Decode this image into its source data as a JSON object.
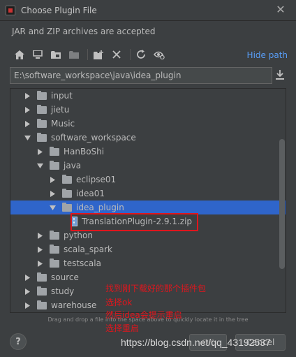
{
  "window": {
    "title": "Choose Plugin File",
    "close_icon": "close-icon"
  },
  "subtitle": "JAR and ZIP archives are accepted",
  "toolbar": {
    "buttons": [
      "home-icon",
      "desktop-icon",
      "project-icon",
      "module-icon",
      "new-folder-icon",
      "delete-icon",
      "refresh-icon",
      "show-hidden-icon"
    ],
    "hide_path_label": "Hide path"
  },
  "path": {
    "value": "E:\\software_workspace\\java\\idea_plugin"
  },
  "tree": {
    "rows": [
      {
        "label": "input",
        "type": "folder",
        "expanded": false,
        "depth": 0
      },
      {
        "label": "jietu",
        "type": "folder",
        "expanded": false,
        "depth": 0
      },
      {
        "label": "Music",
        "type": "folder",
        "expanded": false,
        "depth": 0
      },
      {
        "label": "software_workspace",
        "type": "folder",
        "expanded": true,
        "depth": 0
      },
      {
        "label": "HanBoShi",
        "type": "folder",
        "expanded": false,
        "depth": 1
      },
      {
        "label": "java",
        "type": "folder",
        "expanded": true,
        "depth": 1
      },
      {
        "label": "eclipse01",
        "type": "folder",
        "expanded": false,
        "depth": 2
      },
      {
        "label": "idea01",
        "type": "folder",
        "expanded": false,
        "depth": 2
      },
      {
        "label": "idea_plugin",
        "type": "folder",
        "expanded": true,
        "depth": 2,
        "selected": true
      },
      {
        "label": "TranslationPlugin-2.9.1.zip",
        "type": "zip",
        "depth": 3
      },
      {
        "label": "python",
        "type": "folder",
        "expanded": false,
        "depth": 1
      },
      {
        "label": "scala_spark",
        "type": "folder",
        "expanded": false,
        "depth": 1
      },
      {
        "label": "testscala",
        "type": "folder",
        "expanded": false,
        "depth": 1
      },
      {
        "label": "source",
        "type": "folder",
        "expanded": false,
        "depth": 0
      },
      {
        "label": "study",
        "type": "folder",
        "expanded": false,
        "depth": 0
      },
      {
        "label": "warehouse",
        "type": "folder",
        "expanded": false,
        "depth": 0
      }
    ]
  },
  "hint": "Drag and drop a file into the space above to quickly locate it in the tree",
  "buttons": {
    "help": "?",
    "ok": "OK",
    "cancel": "Cancel"
  },
  "annotations": [
    "找到刚下载好的那个插件包",
    "选择ok",
    "然后idea会提示重启",
    "选择重启"
  ],
  "watermark": "https://blog.csdn.net/qq_43192537",
  "colors": {
    "background": "#3c3f41",
    "selection": "#2f65ca",
    "link": "#589df6",
    "annotation": "#e0161d"
  }
}
